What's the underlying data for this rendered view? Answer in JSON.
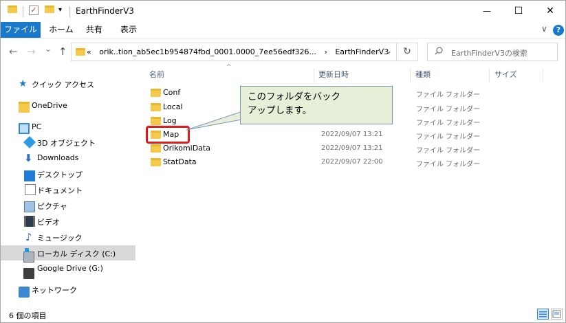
{
  "window": {
    "title": "EarthFinderV3",
    "qat_dropdown_glyph": "▾",
    "minimize_glyph": "—",
    "maximize_glyph": "☐",
    "close_glyph": "✕"
  },
  "ribbon": {
    "tabs": [
      {
        "label": "ファイル"
      },
      {
        "label": "ホーム"
      },
      {
        "label": "共有"
      },
      {
        "label": "表示"
      }
    ],
    "expand_glyph": "∨",
    "help_glyph": "?"
  },
  "address_bar": {
    "back_glyph": "←",
    "forward_glyph": "→",
    "recent_glyph": "⌄",
    "up_glyph": "↑",
    "path_overflow": "«",
    "path_segment_1": "orik..tion_ab5ec1b954874fbd_0001.0000_7ee56edf326...",
    "path_separator": "›",
    "path_segment_2": "EarthFinderV3",
    "dropdown_glyph": "⌄",
    "refresh_glyph": "↻",
    "search_placeholder": "EarthFinderV3の検索"
  },
  "navigation": {
    "items": [
      {
        "label": "クイック アクセス",
        "icon": "star-icon"
      },
      {
        "label": "OneDrive",
        "icon": "onedrive-folder-icon"
      },
      {
        "label": "PC",
        "icon": "pc-icon"
      },
      {
        "label": "3D オブジェクト",
        "icon": "cube-icon"
      },
      {
        "label": "Downloads",
        "icon": "download-icon"
      },
      {
        "label": "デスクトップ",
        "icon": "desktop-icon"
      },
      {
        "label": "ドキュメント",
        "icon": "document-icon"
      },
      {
        "label": "ピクチャ",
        "icon": "picture-icon"
      },
      {
        "label": "ビデオ",
        "icon": "video-icon"
      },
      {
        "label": "ミュージック",
        "icon": "music-icon"
      },
      {
        "label": "ローカル ディスク (C:)",
        "icon": "local-disk-icon"
      },
      {
        "label": "Google Drive (G:)",
        "icon": "drive-icon"
      },
      {
        "label": "ネットワーク",
        "icon": "network-icon"
      }
    ],
    "music_glyph": "♪",
    "download_glyph": "⬇",
    "star_glyph": "★"
  },
  "file_list": {
    "sort_glyph": "^",
    "columns": {
      "name": "名前",
      "modified": "更新日時",
      "type": "種類",
      "size": "サイズ"
    },
    "rows": [
      {
        "name": "Conf",
        "date": "",
        "type": "ファイル フォルダー"
      },
      {
        "name": "Local",
        "date": "",
        "type": "ファイル フォルダー"
      },
      {
        "name": "Log",
        "date": "",
        "type": "ファイル フォルダー"
      },
      {
        "name": "Map",
        "date": "2022/09/07 13:21",
        "type": "ファイル フォルダー"
      },
      {
        "name": "OrikomiData",
        "date": "2022/09/07 13:21",
        "type": "ファイル フォルダー"
      },
      {
        "name": "StatData",
        "date": "2022/09/07 22:00",
        "type": "ファイル フォルダー"
      }
    ]
  },
  "callout": {
    "text_line_1": "このフォルダをバック",
    "text_line_2": "アップします。"
  },
  "status_bar": {
    "item_count": "6 個の項目"
  },
  "colors": {
    "accent": "#1979ca",
    "highlight": "#e01b1b",
    "callout_fill": "#e7efd9",
    "folder": "#f4c94c"
  }
}
